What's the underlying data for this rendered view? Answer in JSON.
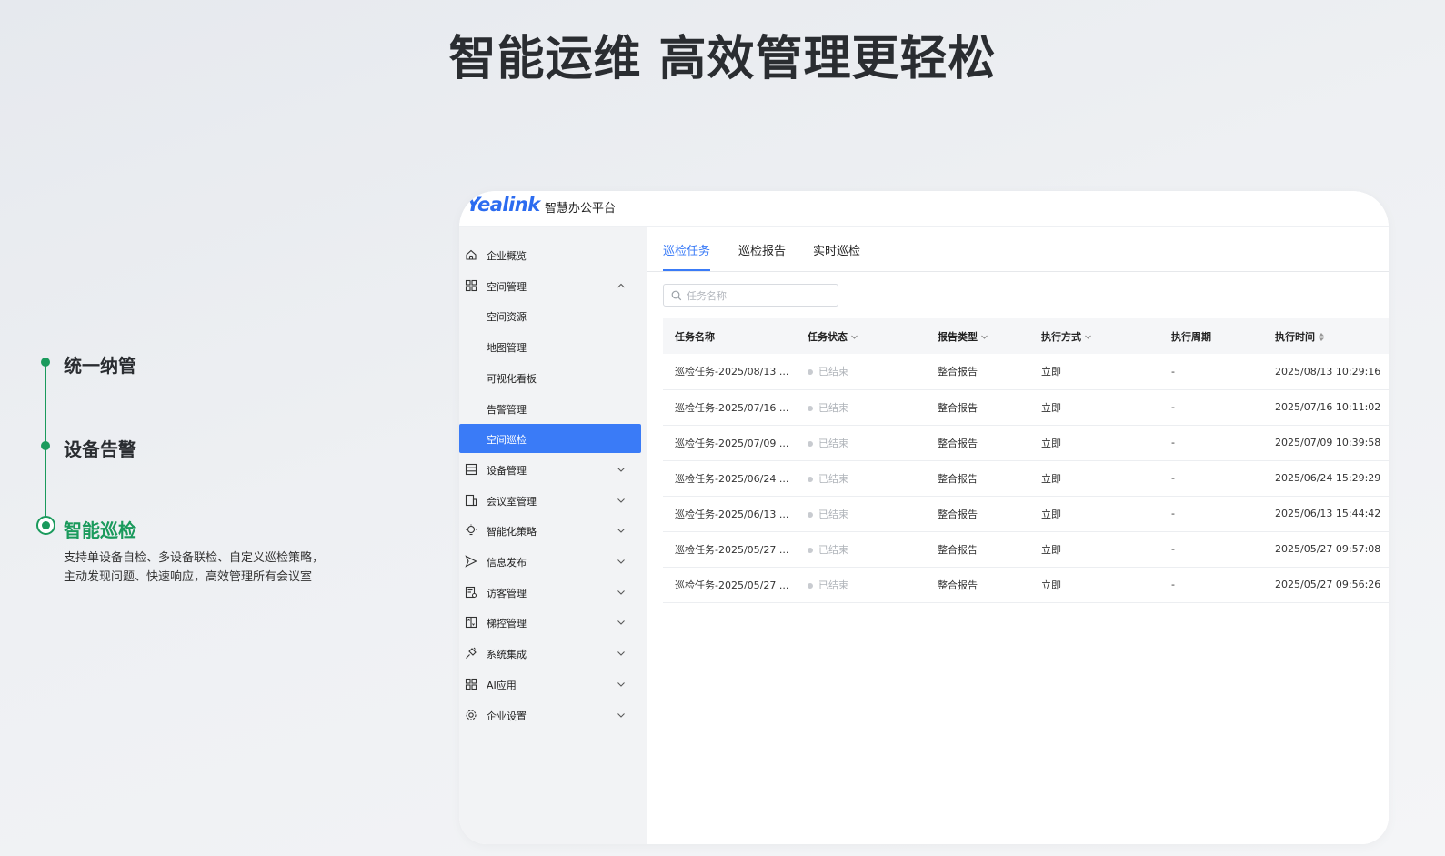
{
  "headline": "智能运维  高效管理更轻松",
  "features": [
    {
      "label": "统一纳管"
    },
    {
      "label": "设备告警"
    },
    {
      "label": "智能巡检",
      "description": "支持单设备自检、多设备联检、自定义巡检策略，主动发现问题、快速响应，高效管理所有会议室"
    }
  ],
  "app": {
    "logo": "Yealink",
    "platform_name": "智慧办公平台",
    "sidebar": {
      "items": [
        {
          "label": "企业概览",
          "icon": "home-icon"
        },
        {
          "label": "空间管理",
          "icon": "grid-icon",
          "expanded": true
        },
        {
          "label": "空间资源",
          "sub": true
        },
        {
          "label": "地图管理",
          "sub": true
        },
        {
          "label": "可视化看板",
          "sub": true
        },
        {
          "label": "告警管理",
          "sub": true
        },
        {
          "label": "空间巡检",
          "sub": true,
          "active": true
        },
        {
          "label": "设备管理",
          "icon": "device-icon"
        },
        {
          "label": "会议室管理",
          "icon": "meeting-room-icon"
        },
        {
          "label": "智能化策略",
          "icon": "bulb-icon"
        },
        {
          "label": "信息发布",
          "icon": "send-icon"
        },
        {
          "label": "访客管理",
          "icon": "visitor-icon"
        },
        {
          "label": "梯控管理",
          "icon": "elevator-icon"
        },
        {
          "label": "系统集成",
          "icon": "plug-icon"
        },
        {
          "label": "AI应用",
          "icon": "ai-grid-icon"
        },
        {
          "label": "企业设置",
          "icon": "gear-icon"
        }
      ]
    },
    "tabs": [
      "巡检任务",
      "巡检报告",
      "实时巡检"
    ],
    "active_tab": 0,
    "search": {
      "placeholder": "任务名称",
      "value": ""
    },
    "table": {
      "columns": [
        "任务名称",
        "任务状态",
        "报告类型",
        "执行方式",
        "执行周期",
        "执行时间"
      ],
      "rows": [
        [
          "巡检任务-2025/08/13 ...",
          "已结束",
          "整合报告",
          "立即",
          "-",
          "2025/08/13 10:29:16"
        ],
        [
          "巡检任务-2025/07/16 ...",
          "已结束",
          "整合报告",
          "立即",
          "-",
          "2025/07/16 10:11:02"
        ],
        [
          "巡检任务-2025/07/09 ...",
          "已结束",
          "整合报告",
          "立即",
          "-",
          "2025/07/09 10:39:58"
        ],
        [
          "巡检任务-2025/06/24 ...",
          "已结束",
          "整合报告",
          "立即",
          "-",
          "2025/06/24 15:29:29"
        ],
        [
          "巡检任务-2025/06/13 ...",
          "已结束",
          "整合报告",
          "立即",
          "-",
          "2025/06/13 15:44:42"
        ],
        [
          "巡检任务-2025/05/27 ...",
          "已结束",
          "整合报告",
          "立即",
          "-",
          "2025/05/27 09:57:08"
        ],
        [
          "巡检任务-2025/05/27 ...",
          "已结束",
          "整合报告",
          "立即",
          "-",
          "2025/05/27 09:56:26"
        ]
      ]
    },
    "colors": {
      "primary": "#3a7bf7",
      "accent_green": "#1a9a5c",
      "sidebar_bg": "#f2f3f5"
    }
  }
}
